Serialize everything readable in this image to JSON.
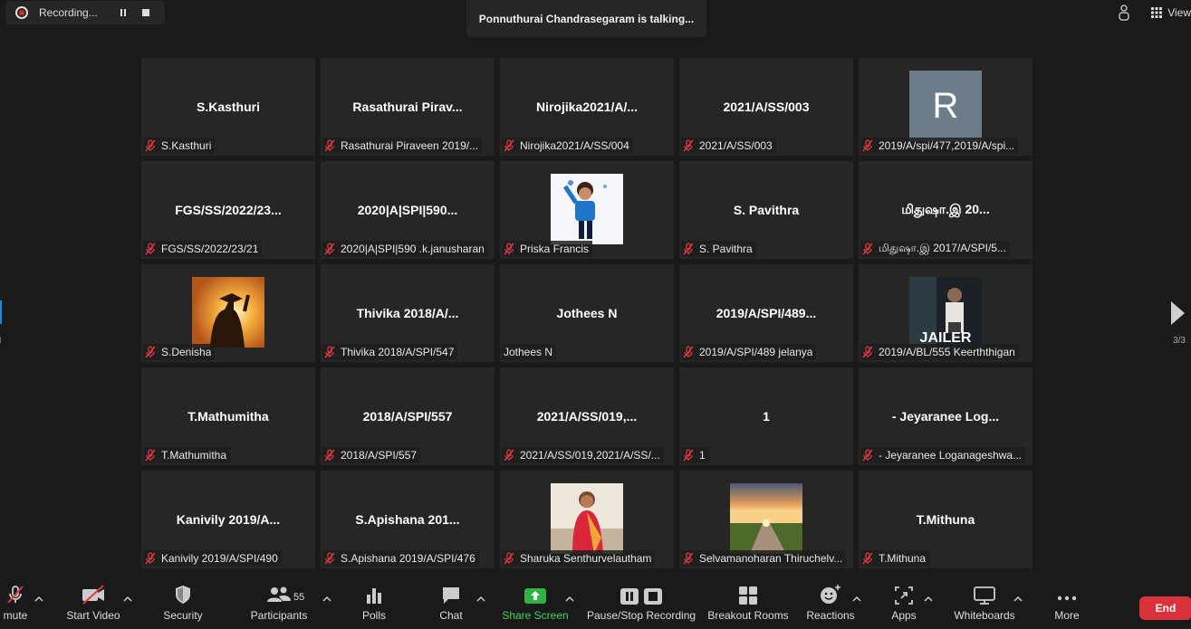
{
  "recording": {
    "label": "Recording..."
  },
  "talking": {
    "text": "Ponnuthurai Chandrasegaram is talking..."
  },
  "view": {
    "label": "View"
  },
  "pagination": {
    "left": "3",
    "right": "3/3"
  },
  "colors": {
    "accent": "#1e88e5",
    "end": "#d9323a",
    "share_green": "#2fb344",
    "tile_bg": "#262626"
  },
  "tiles": [
    {
      "display_name": "S.Kasthuri",
      "label": "S.Kasthuri",
      "muted": true
    },
    {
      "display_name": "Rasathurai  Pirav...",
      "label": "Rasathurai Piraveen 2019/...",
      "muted": true
    },
    {
      "display_name": "Nirojika2021/A/...",
      "label": "Nirojika2021/A/SS/004",
      "muted": true
    },
    {
      "display_name": "2021/A/SS/003",
      "label": "2021/A/SS/003",
      "muted": true
    },
    {
      "avatar_letter": "R",
      "label": "2019/A/spi/477,2019/A/spi...",
      "muted": true
    },
    {
      "display_name": "FGS/SS/2022/23...",
      "label": "FGS/SS/2022/23/21",
      "muted": true
    },
    {
      "display_name": "2020|A|SPI|590...",
      "label": "2020|A|SPI|590 .k.janusharan",
      "muted": true
    },
    {
      "photo": "boy-photo",
      "label": "Priska Francis",
      "muted": true
    },
    {
      "display_name": "S. Pavithra",
      "label": "S. Pavithra",
      "muted": true
    },
    {
      "display_name": "மிதுஷா.இ  20...",
      "label": "மிதுஷா.இ  2017/A/SPI/5...",
      "muted": true
    },
    {
      "photo": "graduate-photo",
      "label": "S.Denisha",
      "muted": true
    },
    {
      "display_name": "Thivika 2018/A/...",
      "label": "Thivika 2018/A/SPI/547",
      "muted": true
    },
    {
      "display_name": "Jothees N",
      "label": "Jothees N",
      "muted": false
    },
    {
      "display_name": "2019/A/SPI/489...",
      "label": "2019/A/SPI/489 jelanya",
      "muted": true
    },
    {
      "photo": "jailer-poster",
      "photo_text": "JAILER",
      "label": "2019/A/BL/555 Keerththigan",
      "muted": true
    },
    {
      "display_name": "T.Mathumitha",
      "label": "T.Mathumitha",
      "muted": true
    },
    {
      "display_name": "2018/A/SPI/557",
      "label": "2018/A/SPI/557",
      "muted": true
    },
    {
      "display_name": "2021/A/SS/019,...",
      "label": "2021/A/SS/019,2021/A/SS/...",
      "muted": true
    },
    {
      "display_name": "1",
      "label": "1",
      "muted": true
    },
    {
      "display_name": "- Jeyaranee Log...",
      "label": "- Jeyaranee Loganageshwa...",
      "muted": true
    },
    {
      "display_name": "Kanivily 2019/A...",
      "label": "Kanivily 2019/A/SPI/490",
      "muted": true
    },
    {
      "display_name": "S.Apishana 201...",
      "label": "S.Apishana 2019/A/SPI/476",
      "muted": true
    },
    {
      "photo": "girl-saree-photo",
      "label": "Sharuka Senthurvelautham",
      "muted": true
    },
    {
      "photo": "sunset-road-photo",
      "label": "Selvamanoharan Thiruchelv...",
      "muted": true
    },
    {
      "display_name": "T.Mithuna",
      "label": "T.Mithuna",
      "muted": true
    }
  ],
  "toolbar": {
    "unmute": "mute",
    "start_video": "Start Video",
    "security": "Security",
    "participants": "Participants",
    "participants_count": "55",
    "polls": "Polls",
    "chat": "Chat",
    "share_screen": "Share Screen",
    "pause_stop": "Pause/Stop Recording",
    "breakout": "Breakout Rooms",
    "reactions": "Reactions",
    "apps": "Apps",
    "whiteboards": "Whiteboards",
    "more": "More",
    "end": "End"
  }
}
